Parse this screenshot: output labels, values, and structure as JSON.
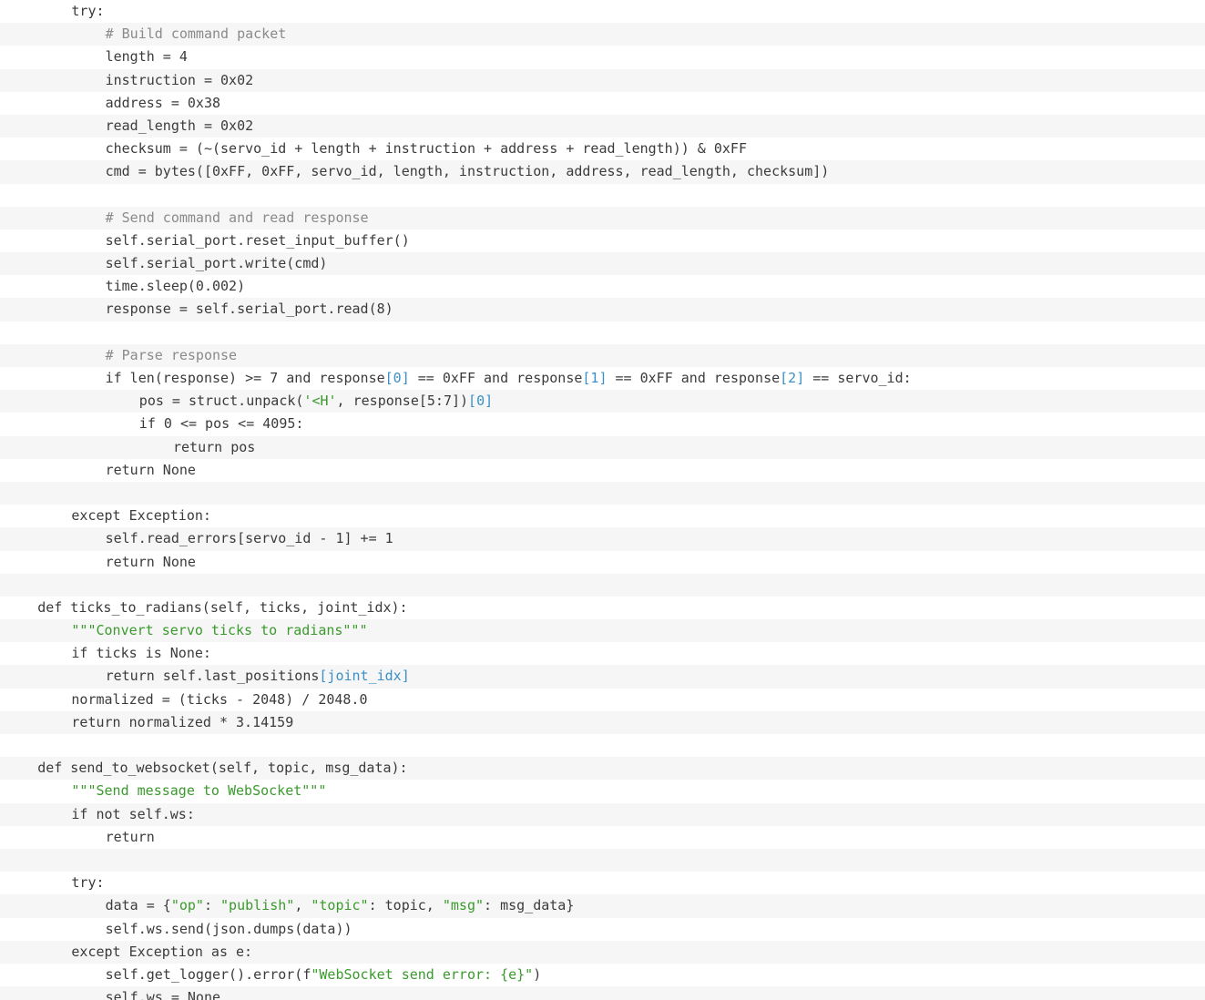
{
  "code": {
    "language": "python",
    "lines": [
      {
        "indent": 2,
        "segments": [
          {
            "t": "try:"
          }
        ]
      },
      {
        "indent": 3,
        "segments": [
          {
            "t": "# Build command packet",
            "c": "comment"
          }
        ]
      },
      {
        "indent": 3,
        "segments": [
          {
            "t": "length = 4"
          }
        ]
      },
      {
        "indent": 3,
        "segments": [
          {
            "t": "instruction = 0x02"
          }
        ]
      },
      {
        "indent": 3,
        "segments": [
          {
            "t": "address = 0x38"
          }
        ]
      },
      {
        "indent": 3,
        "segments": [
          {
            "t": "read_length = 0x02"
          }
        ]
      },
      {
        "indent": 3,
        "segments": [
          {
            "t": "checksum = (~(servo_id + length + instruction + address + read_length)) & 0xFF"
          }
        ]
      },
      {
        "indent": 3,
        "segments": [
          {
            "t": "cmd = bytes([0xFF, 0xFF, servo_id, length, instruction, address, read_length, checksum])"
          }
        ]
      },
      {
        "indent": 0,
        "segments": []
      },
      {
        "indent": 3,
        "segments": [
          {
            "t": "# Send command and read response",
            "c": "comment"
          }
        ]
      },
      {
        "indent": 3,
        "segments": [
          {
            "t": "self.serial_port.reset_input_buffer()"
          }
        ]
      },
      {
        "indent": 3,
        "segments": [
          {
            "t": "self.serial_port.write(cmd)"
          }
        ]
      },
      {
        "indent": 3,
        "segments": [
          {
            "t": "time.sleep(0.002)"
          }
        ]
      },
      {
        "indent": 3,
        "segments": [
          {
            "t": "response = self.serial_port.read(8)"
          }
        ]
      },
      {
        "indent": 0,
        "segments": []
      },
      {
        "indent": 3,
        "segments": [
          {
            "t": "# Parse response",
            "c": "comment"
          }
        ]
      },
      {
        "indent": 3,
        "segments": [
          {
            "t": "if len(response) >= 7 and response"
          },
          {
            "t": "[0]",
            "c": "index"
          },
          {
            "t": " == 0xFF and response"
          },
          {
            "t": "[1]",
            "c": "index"
          },
          {
            "t": " == 0xFF and response"
          },
          {
            "t": "[2]",
            "c": "index"
          },
          {
            "t": " == servo_id:"
          }
        ]
      },
      {
        "indent": 4,
        "segments": [
          {
            "t": "pos = struct.unpack("
          },
          {
            "t": "'<H'",
            "c": "string"
          },
          {
            "t": ", response[5:7])"
          },
          {
            "t": "[0]",
            "c": "index"
          }
        ]
      },
      {
        "indent": 4,
        "segments": [
          {
            "t": "if 0 <= pos <= 4095:"
          }
        ]
      },
      {
        "indent": 5,
        "segments": [
          {
            "t": "return pos"
          }
        ]
      },
      {
        "indent": 3,
        "segments": [
          {
            "t": "return None"
          }
        ]
      },
      {
        "indent": 0,
        "segments": []
      },
      {
        "indent": 2,
        "segments": [
          {
            "t": "except Exception:"
          }
        ]
      },
      {
        "indent": 3,
        "segments": [
          {
            "t": "self.read_errors[servo_id - 1] += 1"
          }
        ]
      },
      {
        "indent": 3,
        "segments": [
          {
            "t": "return None"
          }
        ]
      },
      {
        "indent": 0,
        "segments": []
      },
      {
        "indent": 1,
        "segments": [
          {
            "t": "def ticks_to_radians(self, ticks, joint_idx):"
          }
        ]
      },
      {
        "indent": 2,
        "segments": [
          {
            "t": "\"\"\"Convert servo ticks to radians\"\"\"",
            "c": "string"
          }
        ]
      },
      {
        "indent": 2,
        "segments": [
          {
            "t": "if ticks is None:"
          }
        ]
      },
      {
        "indent": 3,
        "segments": [
          {
            "t": "return self.last_positions"
          },
          {
            "t": "[joint_idx]",
            "c": "index"
          }
        ]
      },
      {
        "indent": 2,
        "segments": [
          {
            "t": "normalized = (ticks - 2048) / 2048.0"
          }
        ]
      },
      {
        "indent": 2,
        "segments": [
          {
            "t": "return normalized * 3.14159"
          }
        ]
      },
      {
        "indent": 0,
        "segments": []
      },
      {
        "indent": 1,
        "segments": [
          {
            "t": "def send_to_websocket(self, topic, msg_data):"
          }
        ]
      },
      {
        "indent": 2,
        "segments": [
          {
            "t": "\"\"\"Send message to WebSocket\"\"\"",
            "c": "string"
          }
        ]
      },
      {
        "indent": 2,
        "segments": [
          {
            "t": "if not self.ws:"
          }
        ]
      },
      {
        "indent": 3,
        "segments": [
          {
            "t": "return"
          }
        ]
      },
      {
        "indent": 0,
        "segments": []
      },
      {
        "indent": 2,
        "segments": [
          {
            "t": "try:"
          }
        ]
      },
      {
        "indent": 3,
        "segments": [
          {
            "t": "data = {"
          },
          {
            "t": "\"op\"",
            "c": "string"
          },
          {
            "t": ": "
          },
          {
            "t": "\"publish\"",
            "c": "string"
          },
          {
            "t": ", "
          },
          {
            "t": "\"topic\"",
            "c": "string"
          },
          {
            "t": ": topic, "
          },
          {
            "t": "\"msg\"",
            "c": "string"
          },
          {
            "t": ": msg_data}"
          }
        ]
      },
      {
        "indent": 3,
        "segments": [
          {
            "t": "self.ws.send(json.dumps(data))"
          }
        ]
      },
      {
        "indent": 2,
        "segments": [
          {
            "t": "except Exception as e:"
          }
        ]
      },
      {
        "indent": 3,
        "segments": [
          {
            "t": "self.get_logger().error(f"
          },
          {
            "t": "\"WebSocket send error: {e}\"",
            "c": "string"
          },
          {
            "t": ")"
          }
        ]
      },
      {
        "indent": 3,
        "segments": [
          {
            "t": "self.ws = None"
          }
        ]
      }
    ]
  }
}
